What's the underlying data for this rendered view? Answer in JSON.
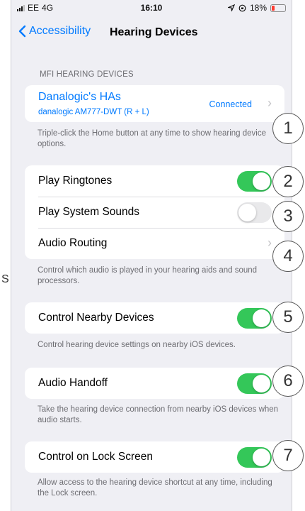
{
  "status_bar": {
    "carrier": "EE",
    "network": "4G",
    "time": "16:10",
    "battery_percent": "18%",
    "battery_level": 0.18,
    "icons": [
      "signal-bars-icon",
      "location-arrow-icon",
      "orientation-lock-icon",
      "battery-icon"
    ]
  },
  "nav": {
    "back_label": "Accessibility",
    "title": "Hearing Devices"
  },
  "mfi": {
    "header": "MFI HEARING DEVICES",
    "device_name": "Danalogic's HAs",
    "device_model": "danalogic AM777-DWT (R + L)",
    "device_status": "Connected",
    "footer": "Triple-click the Home button at any time to show hearing device options."
  },
  "group2": {
    "play_ringtones": {
      "label": "Play Ringtones",
      "on": true
    },
    "play_system_sounds": {
      "label": "Play System Sounds",
      "on": false
    },
    "audio_routing": {
      "label": "Audio Routing"
    },
    "footer": "Control which audio is played in your hearing aids and sound processors."
  },
  "nearby": {
    "label": "Control Nearby Devices",
    "on": true,
    "footer": "Control hearing device settings on nearby iOS devices."
  },
  "handoff": {
    "label": "Audio Handoff",
    "on": true,
    "footer": "Take the hearing device connection from nearby iOS devices when audio starts."
  },
  "lockscreen": {
    "label": "Control on Lock Screen",
    "on": true,
    "footer": "Allow access to the hearing device shortcut at any time, including the Lock screen."
  },
  "callouts": [
    "1",
    "2",
    "3",
    "4",
    "5",
    "6",
    "7"
  ],
  "stray_text": "S"
}
